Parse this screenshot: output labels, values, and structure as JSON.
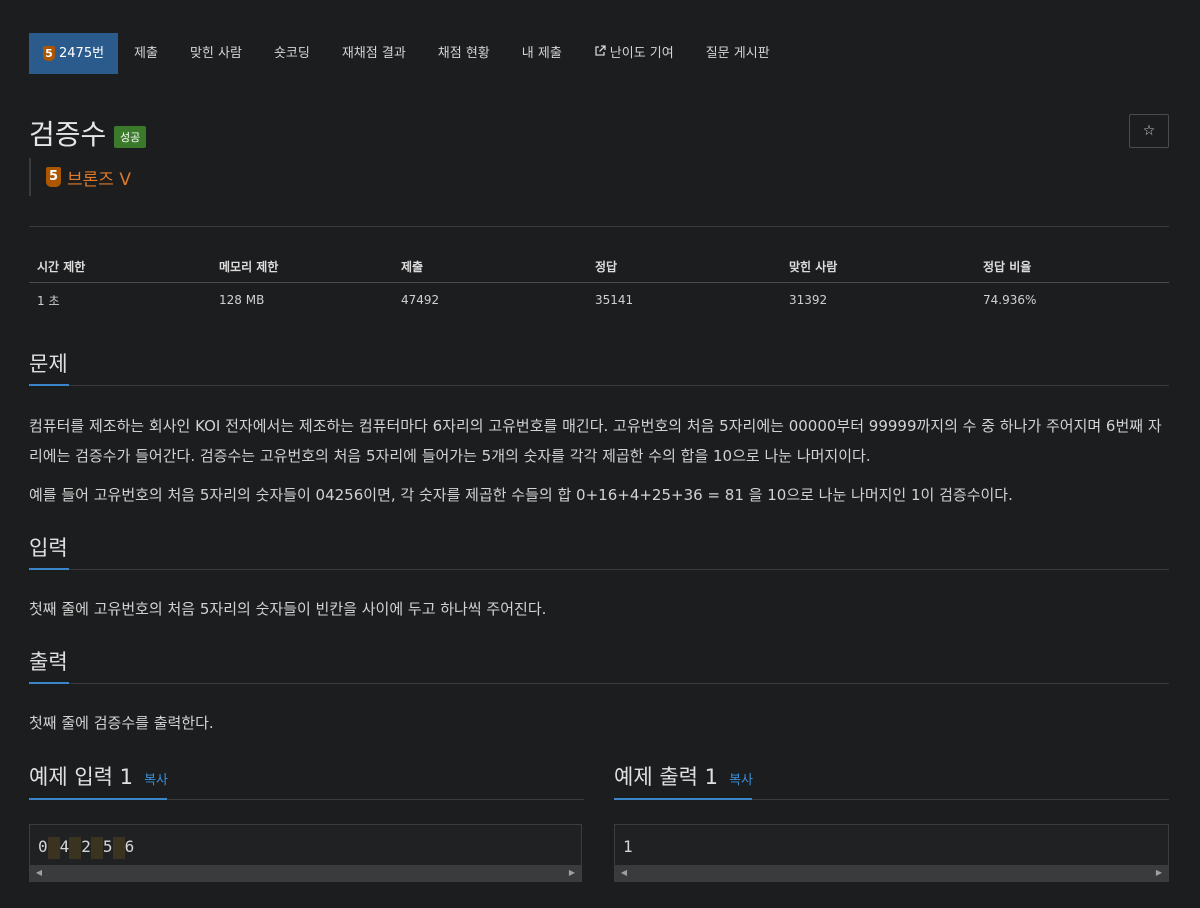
{
  "tabs": [
    {
      "label": "2475번",
      "active": true
    },
    {
      "label": "제출"
    },
    {
      "label": "맞힌 사람"
    },
    {
      "label": "숏코딩"
    },
    {
      "label": "재채점 결과"
    },
    {
      "label": "채점 현황"
    },
    {
      "label": "내 제출"
    },
    {
      "label": "난이도 기여"
    },
    {
      "label": "질문 게시판"
    }
  ],
  "problem": {
    "tier_badge": "5",
    "title": "검증수",
    "status": "성공",
    "tier_label": "브론즈 V",
    "star": "☆"
  },
  "info": {
    "headers": [
      "시간 제한",
      "메모리 제한",
      "제출",
      "정답",
      "맞힌 사람",
      "정답 비율"
    ],
    "values": [
      "1 초",
      "128 MB",
      "47492",
      "35141",
      "31392",
      "74.936%"
    ]
  },
  "sections": {
    "problem_title": "문제",
    "problem_p1": "컴퓨터를 제조하는 회사인 KOI 전자에서는 제조하는 컴퓨터마다 6자리의 고유번호를 매긴다. 고유번호의 처음 5자리에는 00000부터 99999까지의 수 중 하나가 주어지며 6번째 자리에는 검증수가 들어간다. 검증수는 고유번호의 처음 5자리에 들어가는 5개의 숫자를 각각 제곱한 수의 합을 10으로 나눈 나머지이다.",
    "problem_p2": "예를 들어 고유번호의 처음 5자리의 숫자들이 04256이면, 각 숫자를 제곱한 수들의 합 0+16+4+25+36 = 81 을 10으로 나눈 나머지인 1이 검증수이다.",
    "input_title": "입력",
    "input_p": "첫째 줄에 고유번호의 처음 5자리의 숫자들이 빈칸을 사이에 두고 하나씩 주어진다.",
    "output_title": "출력",
    "output_p": "첫째 줄에 검증수를 출력한다."
  },
  "samples": {
    "input_title": "예제 입력 1",
    "output_title": "예제 출력 1",
    "copy_label": "복사",
    "input_digits": [
      "0",
      "4",
      "2",
      "5",
      "6"
    ],
    "output_text": "1"
  },
  "colors": {
    "background": "#1c1d1f",
    "active_tab": "#2b5a8c",
    "bronze": "#ad5600",
    "success": "#3b7a2a",
    "link": "#3a8fd9"
  }
}
